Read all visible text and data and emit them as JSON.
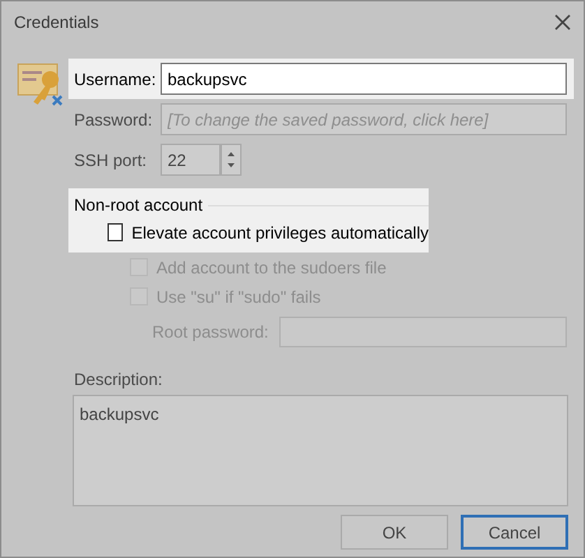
{
  "window": {
    "title": "Credentials"
  },
  "fields": [
    {
      "kind": "text",
      "label": "Username:",
      "value": "backupsvc",
      "highlighted": true
    },
    {
      "kind": "password",
      "label": "Password:",
      "placeholder": "[To change the saved password, click here]",
      "highlighted": false
    },
    {
      "kind": "spin",
      "label": "SSH port:",
      "value": "22",
      "highlighted": false
    }
  ],
  "non_root_group": {
    "title": "Non-root account",
    "highlighted": true,
    "options": [
      {
        "label": "Elevate account privileges automatically",
        "checked": false,
        "disabled": false
      },
      {
        "label": "Add account to the sudoers file",
        "checked": false,
        "disabled": true
      },
      {
        "label": "Use \"su\" if \"sudo\" fails",
        "checked": false,
        "disabled": true
      }
    ],
    "root_password": {
      "label": "Root password:",
      "disabled": true
    }
  },
  "description": {
    "label": "Description:",
    "value": "backupsvc"
  },
  "buttons": [
    {
      "label": "OK",
      "default": false
    },
    {
      "label": "Cancel",
      "default": true
    }
  ]
}
